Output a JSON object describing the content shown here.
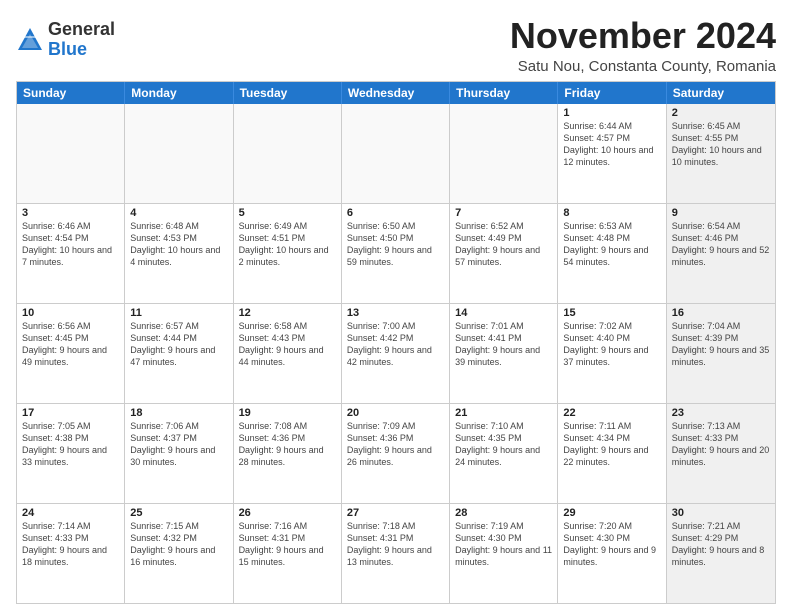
{
  "logo": {
    "general": "General",
    "blue": "Blue"
  },
  "header": {
    "month": "November 2024",
    "location": "Satu Nou, Constanta County, Romania"
  },
  "days_of_week": [
    "Sunday",
    "Monday",
    "Tuesday",
    "Wednesday",
    "Thursday",
    "Friday",
    "Saturday"
  ],
  "weeks": [
    [
      {
        "day": "",
        "detail": "",
        "empty": true
      },
      {
        "day": "",
        "detail": "",
        "empty": true
      },
      {
        "day": "",
        "detail": "",
        "empty": true
      },
      {
        "day": "",
        "detail": "",
        "empty": true
      },
      {
        "day": "",
        "detail": "",
        "empty": true
      },
      {
        "day": "1",
        "detail": "Sunrise: 6:44 AM\nSunset: 4:57 PM\nDaylight: 10 hours and 12 minutes.",
        "empty": false,
        "shaded": false
      },
      {
        "day": "2",
        "detail": "Sunrise: 6:45 AM\nSunset: 4:55 PM\nDaylight: 10 hours and 10 minutes.",
        "empty": false,
        "shaded": true
      }
    ],
    [
      {
        "day": "3",
        "detail": "Sunrise: 6:46 AM\nSunset: 4:54 PM\nDaylight: 10 hours and 7 minutes.",
        "empty": false,
        "shaded": false
      },
      {
        "day": "4",
        "detail": "Sunrise: 6:48 AM\nSunset: 4:53 PM\nDaylight: 10 hours and 4 minutes.",
        "empty": false,
        "shaded": false
      },
      {
        "day": "5",
        "detail": "Sunrise: 6:49 AM\nSunset: 4:51 PM\nDaylight: 10 hours and 2 minutes.",
        "empty": false,
        "shaded": false
      },
      {
        "day": "6",
        "detail": "Sunrise: 6:50 AM\nSunset: 4:50 PM\nDaylight: 9 hours and 59 minutes.",
        "empty": false,
        "shaded": false
      },
      {
        "day": "7",
        "detail": "Sunrise: 6:52 AM\nSunset: 4:49 PM\nDaylight: 9 hours and 57 minutes.",
        "empty": false,
        "shaded": false
      },
      {
        "day": "8",
        "detail": "Sunrise: 6:53 AM\nSunset: 4:48 PM\nDaylight: 9 hours and 54 minutes.",
        "empty": false,
        "shaded": false
      },
      {
        "day": "9",
        "detail": "Sunrise: 6:54 AM\nSunset: 4:46 PM\nDaylight: 9 hours and 52 minutes.",
        "empty": false,
        "shaded": true
      }
    ],
    [
      {
        "day": "10",
        "detail": "Sunrise: 6:56 AM\nSunset: 4:45 PM\nDaylight: 9 hours and 49 minutes.",
        "empty": false,
        "shaded": false
      },
      {
        "day": "11",
        "detail": "Sunrise: 6:57 AM\nSunset: 4:44 PM\nDaylight: 9 hours and 47 minutes.",
        "empty": false,
        "shaded": false
      },
      {
        "day": "12",
        "detail": "Sunrise: 6:58 AM\nSunset: 4:43 PM\nDaylight: 9 hours and 44 minutes.",
        "empty": false,
        "shaded": false
      },
      {
        "day": "13",
        "detail": "Sunrise: 7:00 AM\nSunset: 4:42 PM\nDaylight: 9 hours and 42 minutes.",
        "empty": false,
        "shaded": false
      },
      {
        "day": "14",
        "detail": "Sunrise: 7:01 AM\nSunset: 4:41 PM\nDaylight: 9 hours and 39 minutes.",
        "empty": false,
        "shaded": false
      },
      {
        "day": "15",
        "detail": "Sunrise: 7:02 AM\nSunset: 4:40 PM\nDaylight: 9 hours and 37 minutes.",
        "empty": false,
        "shaded": false
      },
      {
        "day": "16",
        "detail": "Sunrise: 7:04 AM\nSunset: 4:39 PM\nDaylight: 9 hours and 35 minutes.",
        "empty": false,
        "shaded": true
      }
    ],
    [
      {
        "day": "17",
        "detail": "Sunrise: 7:05 AM\nSunset: 4:38 PM\nDaylight: 9 hours and 33 minutes.",
        "empty": false,
        "shaded": false
      },
      {
        "day": "18",
        "detail": "Sunrise: 7:06 AM\nSunset: 4:37 PM\nDaylight: 9 hours and 30 minutes.",
        "empty": false,
        "shaded": false
      },
      {
        "day": "19",
        "detail": "Sunrise: 7:08 AM\nSunset: 4:36 PM\nDaylight: 9 hours and 28 minutes.",
        "empty": false,
        "shaded": false
      },
      {
        "day": "20",
        "detail": "Sunrise: 7:09 AM\nSunset: 4:36 PM\nDaylight: 9 hours and 26 minutes.",
        "empty": false,
        "shaded": false
      },
      {
        "day": "21",
        "detail": "Sunrise: 7:10 AM\nSunset: 4:35 PM\nDaylight: 9 hours and 24 minutes.",
        "empty": false,
        "shaded": false
      },
      {
        "day": "22",
        "detail": "Sunrise: 7:11 AM\nSunset: 4:34 PM\nDaylight: 9 hours and 22 minutes.",
        "empty": false,
        "shaded": false
      },
      {
        "day": "23",
        "detail": "Sunrise: 7:13 AM\nSunset: 4:33 PM\nDaylight: 9 hours and 20 minutes.",
        "empty": false,
        "shaded": true
      }
    ],
    [
      {
        "day": "24",
        "detail": "Sunrise: 7:14 AM\nSunset: 4:33 PM\nDaylight: 9 hours and 18 minutes.",
        "empty": false,
        "shaded": false
      },
      {
        "day": "25",
        "detail": "Sunrise: 7:15 AM\nSunset: 4:32 PM\nDaylight: 9 hours and 16 minutes.",
        "empty": false,
        "shaded": false
      },
      {
        "day": "26",
        "detail": "Sunrise: 7:16 AM\nSunset: 4:31 PM\nDaylight: 9 hours and 15 minutes.",
        "empty": false,
        "shaded": false
      },
      {
        "day": "27",
        "detail": "Sunrise: 7:18 AM\nSunset: 4:31 PM\nDaylight: 9 hours and 13 minutes.",
        "empty": false,
        "shaded": false
      },
      {
        "day": "28",
        "detail": "Sunrise: 7:19 AM\nSunset: 4:30 PM\nDaylight: 9 hours and 11 minutes.",
        "empty": false,
        "shaded": false
      },
      {
        "day": "29",
        "detail": "Sunrise: 7:20 AM\nSunset: 4:30 PM\nDaylight: 9 hours and 9 minutes.",
        "empty": false,
        "shaded": false
      },
      {
        "day": "30",
        "detail": "Sunrise: 7:21 AM\nSunset: 4:29 PM\nDaylight: 9 hours and 8 minutes.",
        "empty": false,
        "shaded": true
      }
    ]
  ]
}
